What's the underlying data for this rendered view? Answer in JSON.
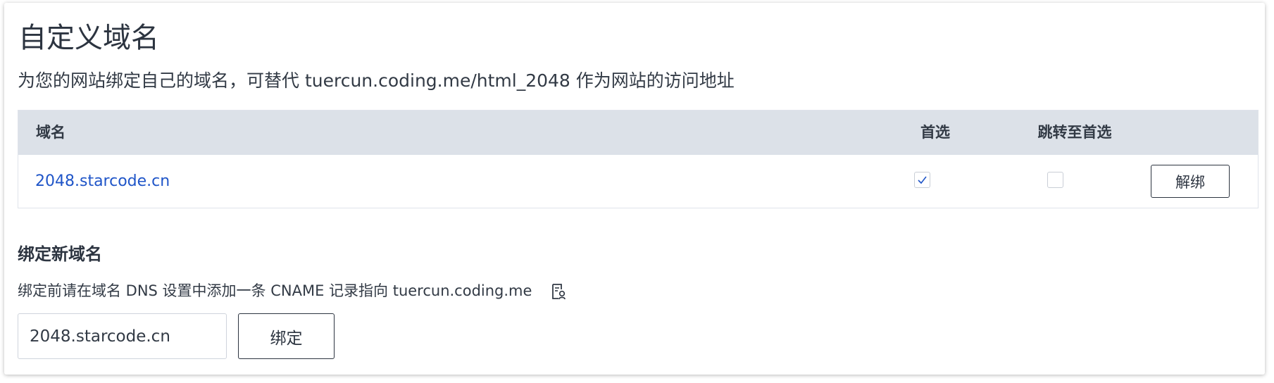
{
  "page": {
    "title": "自定义域名",
    "description": "为您的网站绑定自己的域名，可替代 tuercun.coding.me/html_2048 作为网站的访问地址"
  },
  "table": {
    "headers": {
      "domain": "域名",
      "primary": "首选",
      "redirect": "跳转至首选"
    },
    "rows": [
      {
        "domain": "2048.starcode.cn",
        "primary": true,
        "redirect": false,
        "action_label": "解绑"
      }
    ]
  },
  "bind_section": {
    "title": "绑定新域名",
    "hint": "绑定前请在域名 DNS 设置中添加一条 CNAME 记录指向 tuercun.coding.me",
    "hint_icon": "document-help-icon",
    "input_value": "2048.starcode.cn",
    "button_label": "绑定"
  },
  "colors": {
    "link": "#1f55c8",
    "header_bg": "#dce1e8",
    "text": "#323a45",
    "check": "#1f55c8"
  }
}
